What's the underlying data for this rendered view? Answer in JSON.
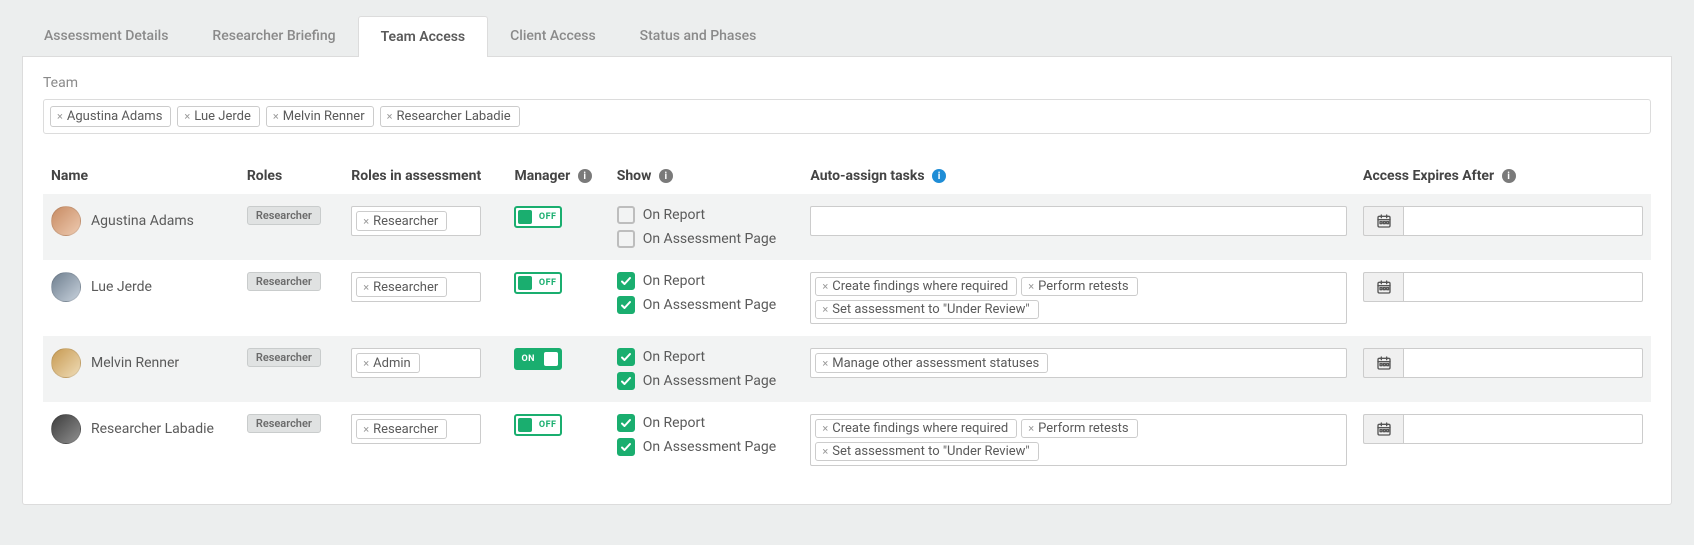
{
  "tabs": {
    "items": [
      {
        "label": "Assessment Details",
        "active": false
      },
      {
        "label": "Researcher Briefing",
        "active": false
      },
      {
        "label": "Team Access",
        "active": true
      },
      {
        "label": "Client Access",
        "active": false
      },
      {
        "label": "Status and Phases",
        "active": false
      }
    ]
  },
  "team_section_label": "Team",
  "team_chips": [
    "Agustina Adams",
    "Lue Jerde",
    "Melvin Renner",
    "Researcher Labadie"
  ],
  "columns": {
    "name": "Name",
    "roles": "Roles",
    "roles_in_assessment": "Roles in assessment",
    "manager": "Manager",
    "show": "Show",
    "auto_assign": "Auto-assign tasks",
    "access_expires": "Access Expires After"
  },
  "toggle_labels": {
    "on": "ON",
    "off": "OFF"
  },
  "show_options": {
    "on_report": "On Report",
    "on_assessment_page": "On Assessment Page"
  },
  "rows": [
    {
      "name": "Agustina Adams",
      "avatar_variant": "a",
      "role_badge": "Researcher",
      "roles_in_assessment": [
        "Researcher"
      ],
      "manager_on": false,
      "show_on_report": false,
      "show_on_page": false,
      "auto_assign": [],
      "access_expires": ""
    },
    {
      "name": "Lue Jerde",
      "avatar_variant": "b",
      "role_badge": "Researcher",
      "roles_in_assessment": [
        "Researcher"
      ],
      "manager_on": false,
      "show_on_report": true,
      "show_on_page": true,
      "auto_assign": [
        "Create findings where required",
        "Perform retests",
        "Set assessment to \"Under Review\""
      ],
      "access_expires": ""
    },
    {
      "name": "Melvin Renner",
      "avatar_variant": "c",
      "role_badge": "Researcher",
      "roles_in_assessment": [
        "Admin"
      ],
      "manager_on": true,
      "show_on_report": true,
      "show_on_page": true,
      "auto_assign": [
        "Manage other assessment statuses"
      ],
      "access_expires": ""
    },
    {
      "name": "Researcher Labadie",
      "avatar_variant": "d",
      "role_badge": "Researcher",
      "roles_in_assessment": [
        "Researcher"
      ],
      "manager_on": false,
      "show_on_report": true,
      "show_on_page": true,
      "auto_assign": [
        "Create findings where required",
        "Perform retests",
        "Set assessment to \"Under Review\""
      ],
      "access_expires": ""
    }
  ]
}
